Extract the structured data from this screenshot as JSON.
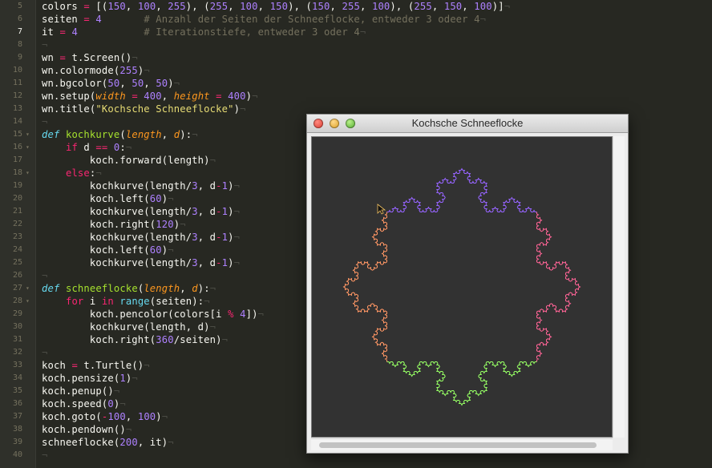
{
  "editor": {
    "gutter": [
      "5",
      "6",
      "7",
      "8",
      "9",
      "10",
      "11",
      "12",
      "13",
      "14",
      "15",
      "16",
      "17",
      "18",
      "19",
      "20",
      "21",
      "22",
      "23",
      "24",
      "25",
      "26",
      "27",
      "28",
      "29",
      "30",
      "31",
      "32",
      "33",
      "34",
      "35",
      "36",
      "37",
      "38",
      "39",
      "40"
    ],
    "active_line": "7",
    "lines": [
      [
        [
          "v",
          "colors"
        ],
        [
          "o",
          " = "
        ],
        [
          "t",
          "[("
        ],
        [
          "n",
          "150"
        ],
        [
          "t",
          ", "
        ],
        [
          "n",
          "100"
        ],
        [
          "t",
          ", "
        ],
        [
          "n",
          "255"
        ],
        [
          "t",
          "), ("
        ],
        [
          "n",
          "255"
        ],
        [
          "t",
          ", "
        ],
        [
          "n",
          "100"
        ],
        [
          "t",
          ", "
        ],
        [
          "n",
          "150"
        ],
        [
          "t",
          "), ("
        ],
        [
          "n",
          "150"
        ],
        [
          "t",
          ", "
        ],
        [
          "n",
          "255"
        ],
        [
          "t",
          ", "
        ],
        [
          "n",
          "100"
        ],
        [
          "t",
          "), ("
        ],
        [
          "n",
          "255"
        ],
        [
          "t",
          ", "
        ],
        [
          "n",
          "150"
        ],
        [
          "t",
          ", "
        ],
        [
          "n",
          "100"
        ],
        [
          "t",
          ")]"
        ]
      ],
      [
        [
          "v",
          "seiten"
        ],
        [
          "o",
          " = "
        ],
        [
          "n",
          "4"
        ],
        [
          "t",
          "       "
        ],
        [
          "c",
          "# Anzahl der Seiten der Schneeflocke, entweder 3 odeer 4"
        ]
      ],
      [
        [
          "v",
          "it"
        ],
        [
          "o",
          " = "
        ],
        [
          "n",
          "4"
        ],
        [
          "t",
          "           "
        ],
        [
          "c",
          "# Iterationstiefe, entweder 3 oder 4"
        ]
      ],
      [],
      [
        [
          "v",
          "wn"
        ],
        [
          "o",
          " = "
        ],
        [
          "t",
          "t.Screen()"
        ]
      ],
      [
        [
          "t",
          "wn.colormode("
        ],
        [
          "n",
          "255"
        ],
        [
          "t",
          ")"
        ]
      ],
      [
        [
          "t",
          "wn.bgcolor("
        ],
        [
          "n",
          "50"
        ],
        [
          "t",
          ", "
        ],
        [
          "n",
          "50"
        ],
        [
          "t",
          ", "
        ],
        [
          "n",
          "50"
        ],
        [
          "t",
          ")"
        ]
      ],
      [
        [
          "t",
          "wn.setup("
        ],
        [
          "p",
          "width"
        ],
        [
          "o",
          " = "
        ],
        [
          "n",
          "400"
        ],
        [
          "t",
          ", "
        ],
        [
          "p",
          "height"
        ],
        [
          "o",
          " = "
        ],
        [
          "n",
          "400"
        ],
        [
          "t",
          ")"
        ]
      ],
      [
        [
          "t",
          "wn.title("
        ],
        [
          "s",
          "\"Kochsche Schneeflocke\""
        ],
        [
          "t",
          ")"
        ]
      ],
      [],
      [
        [
          "sd",
          "def "
        ],
        [
          "f",
          "kochkurve"
        ],
        [
          "t",
          "("
        ],
        [
          "p",
          "length"
        ],
        [
          "t",
          ", "
        ],
        [
          "p",
          "d"
        ],
        [
          "t",
          "):"
        ]
      ],
      [
        [
          "t",
          "    "
        ],
        [
          "k",
          "if "
        ],
        [
          "t",
          "d "
        ],
        [
          "k",
          "=="
        ],
        [
          "t",
          " "
        ],
        [
          "n",
          "0"
        ],
        [
          "t",
          ":"
        ]
      ],
      [
        [
          "t",
          "        koch.forward(length)"
        ]
      ],
      [
        [
          "t",
          "    "
        ],
        [
          "k",
          "else"
        ],
        [
          "t",
          ":"
        ]
      ],
      [
        [
          "t",
          "        kochkurve(length/"
        ],
        [
          "n",
          "3"
        ],
        [
          "t",
          ", d"
        ],
        [
          "k",
          "-"
        ],
        [
          "n",
          "1"
        ],
        [
          "t",
          ")"
        ]
      ],
      [
        [
          "t",
          "        koch.left("
        ],
        [
          "n",
          "60"
        ],
        [
          "t",
          ")"
        ]
      ],
      [
        [
          "t",
          "        kochkurve(length/"
        ],
        [
          "n",
          "3"
        ],
        [
          "t",
          ", d"
        ],
        [
          "k",
          "-"
        ],
        [
          "n",
          "1"
        ],
        [
          "t",
          ")"
        ]
      ],
      [
        [
          "t",
          "        koch.right("
        ],
        [
          "n",
          "120"
        ],
        [
          "t",
          ")"
        ]
      ],
      [
        [
          "t",
          "        kochkurve(length/"
        ],
        [
          "n",
          "3"
        ],
        [
          "t",
          ", d"
        ],
        [
          "k",
          "-"
        ],
        [
          "n",
          "1"
        ],
        [
          "t",
          ")"
        ]
      ],
      [
        [
          "t",
          "        koch.left("
        ],
        [
          "n",
          "60"
        ],
        [
          "t",
          ")"
        ]
      ],
      [
        [
          "t",
          "        kochkurve(length/"
        ],
        [
          "n",
          "3"
        ],
        [
          "t",
          ", d"
        ],
        [
          "k",
          "-"
        ],
        [
          "n",
          "1"
        ],
        [
          "t",
          ")"
        ]
      ],
      [],
      [
        [
          "sd",
          "def "
        ],
        [
          "f",
          "schneeflocke"
        ],
        [
          "t",
          "("
        ],
        [
          "p",
          "length"
        ],
        [
          "t",
          ", "
        ],
        [
          "p",
          "d"
        ],
        [
          "t",
          "):"
        ]
      ],
      [
        [
          "t",
          "    "
        ],
        [
          "k",
          "for "
        ],
        [
          "t",
          "i "
        ],
        [
          "k",
          "in "
        ],
        [
          "b",
          "range"
        ],
        [
          "t",
          "(seiten):"
        ]
      ],
      [
        [
          "t",
          "        koch.pencolor(colors[i "
        ],
        [
          "k",
          "%"
        ],
        [
          "t",
          " "
        ],
        [
          "n",
          "4"
        ],
        [
          "t",
          "])"
        ]
      ],
      [
        [
          "t",
          "        kochkurve(length, d)"
        ]
      ],
      [
        [
          "t",
          "        koch.right("
        ],
        [
          "n",
          "360"
        ],
        [
          "t",
          "/seiten)"
        ]
      ],
      [],
      [
        [
          "v",
          "koch"
        ],
        [
          "o",
          " = "
        ],
        [
          "t",
          "t.Turtle()"
        ]
      ],
      [
        [
          "t",
          "koch.pensize("
        ],
        [
          "n",
          "1"
        ],
        [
          "t",
          ")"
        ]
      ],
      [
        [
          "t",
          "koch.penup()"
        ]
      ],
      [
        [
          "t",
          "koch.speed("
        ],
        [
          "n",
          "0"
        ],
        [
          "t",
          ")"
        ]
      ],
      [
        [
          "t",
          "koch.goto("
        ],
        [
          "k",
          "-"
        ],
        [
          "n",
          "100"
        ],
        [
          "t",
          ", "
        ],
        [
          "n",
          "100"
        ],
        [
          "t",
          ")"
        ]
      ],
      [
        [
          "t",
          "koch.pendown()"
        ]
      ],
      [
        [
          "t",
          "schneeflocke("
        ],
        [
          "n",
          "200"
        ],
        [
          "t",
          ", it)"
        ]
      ],
      []
    ]
  },
  "window": {
    "title": "Kochsche Schneeflocke",
    "buttons": [
      "close-button",
      "minimize-button",
      "maximize-button"
    ]
  },
  "drawing": {
    "sides": 4,
    "depth": 4,
    "length": 200,
    "start": [
      -100,
      100
    ],
    "background": "#323232",
    "pen_colors": [
      "#9664ff",
      "#ff6496",
      "#96ff64",
      "#ff9664"
    ]
  },
  "colors": {
    "editor_bg": "#272822",
    "keyword": "#f92672",
    "number": "#ae81ff",
    "string": "#e6db74",
    "comment": "#75715e",
    "function": "#a6e22e",
    "param": "#fd971f"
  },
  "icons": {
    "cursor": "arrow-cursor-icon"
  }
}
